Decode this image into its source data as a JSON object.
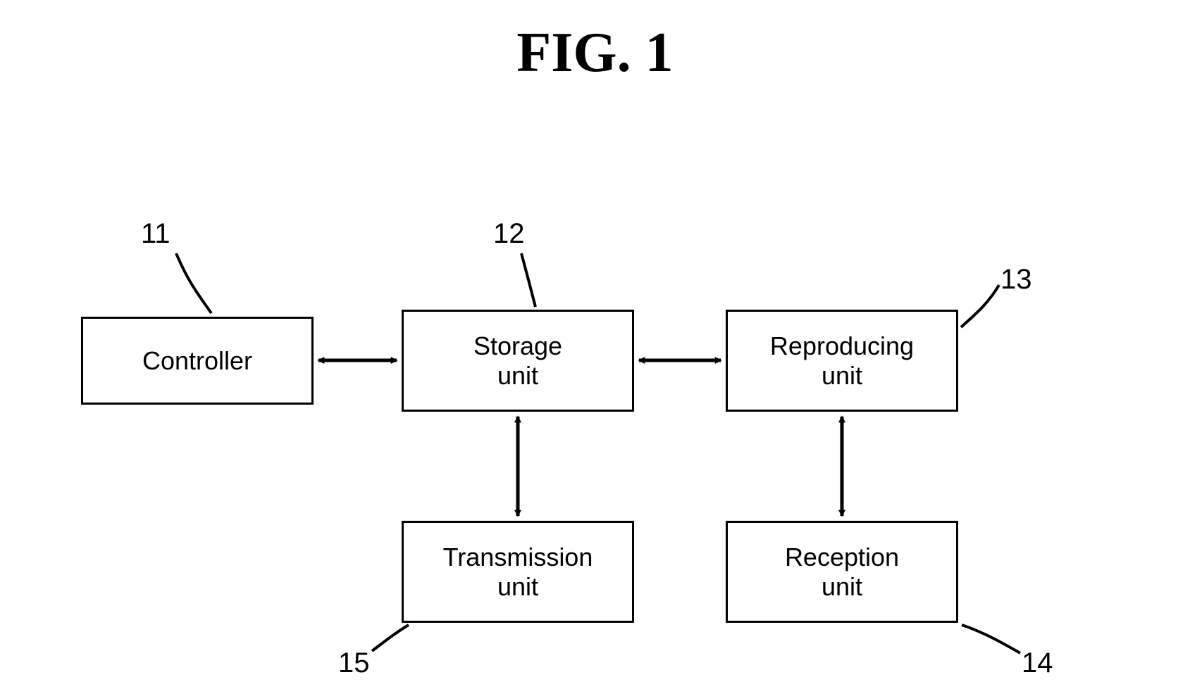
{
  "title": "FIG. 1",
  "boxes": {
    "controller": {
      "num": "11",
      "label": "Controller"
    },
    "storage": {
      "num": "12",
      "label": "Storage\nunit"
    },
    "reproducing": {
      "num": "13",
      "label": "Reproducing\nunit"
    },
    "reception": {
      "num": "14",
      "label": "Reception\nunit"
    },
    "transmission": {
      "num": "15",
      "label": "Transmission\nunit"
    }
  }
}
